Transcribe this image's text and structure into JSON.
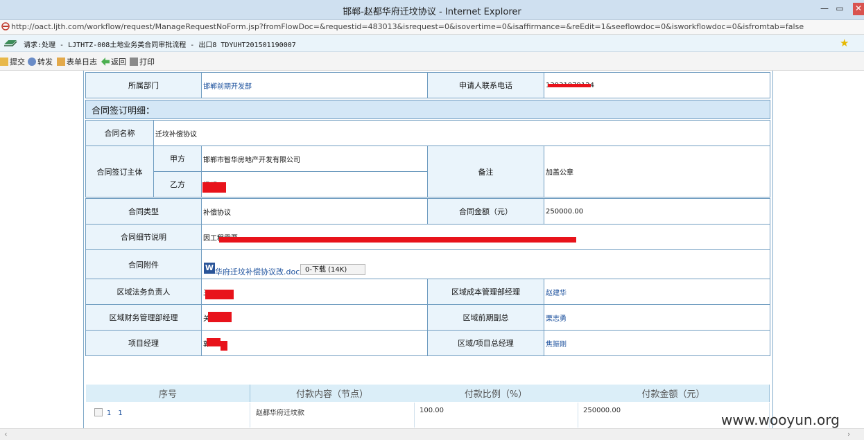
{
  "window": {
    "title": "邯郸-赵都华府迁坟协议 - Internet Explorer",
    "minimize": "—",
    "maximize": "▭",
    "close": "✕"
  },
  "address": {
    "url": "http://oact.ljth.com/workflow/request/ManageRequestNoForm.jsp?fromFlowDoc=&requestid=483013&isrequest=0&isovertime=0&isaffirmance=&reEdit=1&seeflowdoc=0&isworkflowdoc=0&isfromtab=false"
  },
  "request": {
    "text": "请求:处理 - LJTHTZ-008土地业务类合同审批流程 - 出口8 TDYUHT201501190007"
  },
  "toolbar": {
    "submit": "提交",
    "forward": "转发",
    "log": "表单日志",
    "back": "返回",
    "print": "打印"
  },
  "form": {
    "dept_label": "所属部门",
    "dept_value": "邯郸前期开发部",
    "phone_label": "申请人联系电话",
    "phone_value": "13931079124",
    "section_title": "合同签订明细：",
    "contract_name_label": "合同名称",
    "contract_name_value": "迁坟补偿协议",
    "parties_label": "合同签订主体",
    "party_a_label": "甲方",
    "party_a_value": "邯郸市智华房地产开发有限公司",
    "party_b_label": "乙方",
    "party_b_value": "温明日",
    "remark_label": "备注",
    "remark_value": "加盖公章",
    "type_label": "合同类型",
    "type_value": "补偿协议",
    "amount_label": "合同金额（元）",
    "amount_value": "250000.00",
    "detail_label": "合同细节说明",
    "detail_value": "因工程需要，",
    "attach_label": "合同附件",
    "attach_file": "华府迁坟补偿协议改.docx",
    "attach_button": "0-下载 (14K)",
    "legal_label": "区域法务负责人",
    "legal_value": "王",
    "cost_mgr_label": "区域成本管理部经理",
    "cost_mgr_value": "赵建华",
    "finance_label": "区域财务管理部经理",
    "finance_value": "关",
    "vp_label": "区域前期副总",
    "vp_value": "栗志勇",
    "pm_label": "项目经理",
    "pm_value": "郭",
    "gm_label": "区域/项目总经理",
    "gm_value": "焦振刚"
  },
  "payment": {
    "headers": [
      "序号",
      "付款内容（节点）",
      "付款比例（%）",
      "付款金额（元）"
    ],
    "row": {
      "seq_a": "1",
      "seq_b": "1",
      "content": "赵都华府迁坟款",
      "ratio": "100.00",
      "amount": "250000.00"
    }
  },
  "watermark": "www.wooyun.org",
  "colors": {
    "header_bg": "#eaf4fb",
    "section_bg": "#d4e7f6",
    "border": "#6f9cc0",
    "link": "#1a4f9c",
    "redaction": "#e8131b"
  }
}
